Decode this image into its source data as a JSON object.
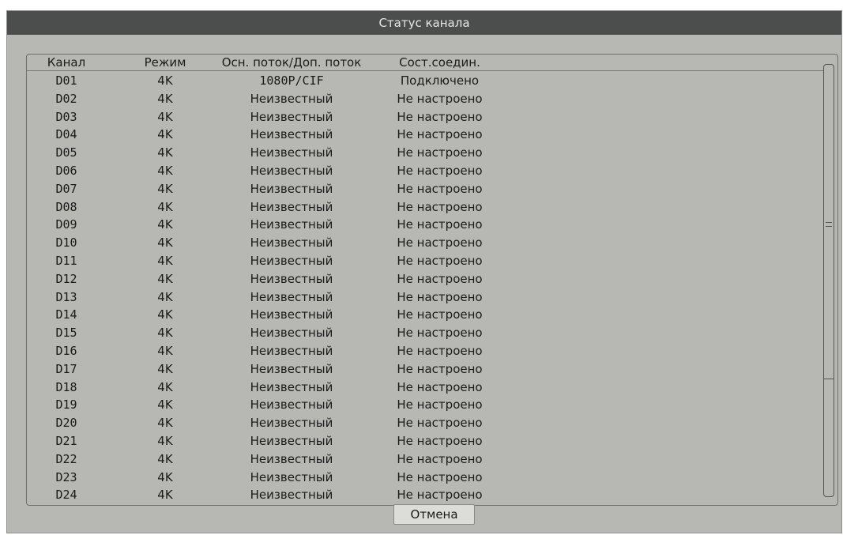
{
  "window": {
    "title": "Статус канала"
  },
  "table": {
    "columns": [
      "Канал",
      "Режим",
      "Осн. поток/Доп. поток",
      "Сост.соедин."
    ],
    "rows": [
      {
        "channel": "D01",
        "mode": "4K",
        "stream": "1080P/CIF",
        "status": "Подключено"
      },
      {
        "channel": "D02",
        "mode": "4K",
        "stream": "Неизвестный",
        "status": "Не настроено"
      },
      {
        "channel": "D03",
        "mode": "4K",
        "stream": "Неизвестный",
        "status": "Не настроено"
      },
      {
        "channel": "D04",
        "mode": "4K",
        "stream": "Неизвестный",
        "status": "Не настроено"
      },
      {
        "channel": "D05",
        "mode": "4K",
        "stream": "Неизвестный",
        "status": "Не настроено"
      },
      {
        "channel": "D06",
        "mode": "4K",
        "stream": "Неизвестный",
        "status": "Не настроено"
      },
      {
        "channel": "D07",
        "mode": "4K",
        "stream": "Неизвестный",
        "status": "Не настроено"
      },
      {
        "channel": "D08",
        "mode": "4K",
        "stream": "Неизвестный",
        "status": "Не настроено"
      },
      {
        "channel": "D09",
        "mode": "4K",
        "stream": "Неизвестный",
        "status": "Не настроено"
      },
      {
        "channel": "D10",
        "mode": "4K",
        "stream": "Неизвестный",
        "status": "Не настроено"
      },
      {
        "channel": "D11",
        "mode": "4K",
        "stream": "Неизвестный",
        "status": "Не настроено"
      },
      {
        "channel": "D12",
        "mode": "4K",
        "stream": "Неизвестный",
        "status": "Не настроено"
      },
      {
        "channel": "D13",
        "mode": "4K",
        "stream": "Неизвестный",
        "status": "Не настроено"
      },
      {
        "channel": "D14",
        "mode": "4K",
        "stream": "Неизвестный",
        "status": "Не настроено"
      },
      {
        "channel": "D15",
        "mode": "4K",
        "stream": "Неизвестный",
        "status": "Не настроено"
      },
      {
        "channel": "D16",
        "mode": "4K",
        "stream": "Неизвестный",
        "status": "Не настроено"
      },
      {
        "channel": "D17",
        "mode": "4K",
        "stream": "Неизвестный",
        "status": "Не настроено"
      },
      {
        "channel": "D18",
        "mode": "4K",
        "stream": "Неизвестный",
        "status": "Не настроено"
      },
      {
        "channel": "D19",
        "mode": "4K",
        "stream": "Неизвестный",
        "status": "Не настроено"
      },
      {
        "channel": "D20",
        "mode": "4K",
        "stream": "Неизвестный",
        "status": "Не настроено"
      },
      {
        "channel": "D21",
        "mode": "4K",
        "stream": "Неизвестный",
        "status": "Не настроено"
      },
      {
        "channel": "D22",
        "mode": "4K",
        "stream": "Неизвестный",
        "status": "Не настроено"
      },
      {
        "channel": "D23",
        "mode": "4K",
        "stream": "Неизвестный",
        "status": "Не настроено"
      },
      {
        "channel": "D24",
        "mode": "4K",
        "stream": "Неизвестный",
        "status": "Не настроено"
      }
    ]
  },
  "buttons": {
    "cancel": "Отмена"
  },
  "colors": {
    "titlebar_bg": "#4c4e4d",
    "dialog_bg": "#b7b8b3",
    "text": "#1a1a1a"
  }
}
